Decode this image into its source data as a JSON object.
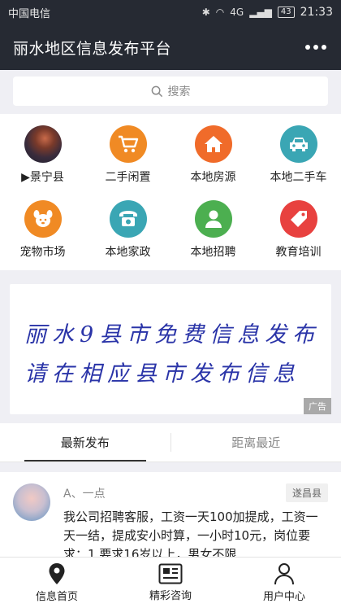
{
  "status_bar": {
    "carrier": "中国电信",
    "battery": "43",
    "time": "21:33",
    "network": "4G"
  },
  "header": {
    "title": "丽水地区信息发布平台"
  },
  "search": {
    "placeholder": "搜索"
  },
  "categories": [
    {
      "label": "▶景宁县",
      "icon": "region-avatar-icon",
      "color": "#3a2c3c"
    },
    {
      "label": "二手闲置",
      "icon": "shopping-cart-icon",
      "color": "#f08a24"
    },
    {
      "label": "本地房源",
      "icon": "house-icon",
      "color": "#f06b2a"
    },
    {
      "label": "本地二手车",
      "icon": "car-icon",
      "color": "#3aa6b4"
    },
    {
      "label": "宠物市场",
      "icon": "pet-icon",
      "color": "#f08a24"
    },
    {
      "label": "本地家政",
      "icon": "telephone-icon",
      "color": "#3aa6b4"
    },
    {
      "label": "本地招聘",
      "icon": "person-icon",
      "color": "#4caf50"
    },
    {
      "label": "教育培训",
      "icon": "price-tag-icon",
      "color": "#e8413f"
    }
  ],
  "banner": {
    "line1": "丽水9县市免费信息发布",
    "line2": "请在相应县市发布信息",
    "ad_label": "广告",
    "text_color": "#2a34a8"
  },
  "tabs": [
    {
      "label": "最新发布",
      "active": true
    },
    {
      "label": "距离最近",
      "active": false
    }
  ],
  "post": {
    "user": "A、一点",
    "tag": "遂昌县",
    "text": "我公司招聘客服，工资一天100加提成，工资一天一结，提成安小时算，一小时10元，岗位要求：1.要求16岁以上，男女不限"
  },
  "bottom_nav": [
    {
      "label": "信息首页",
      "icon": "location-pin-icon"
    },
    {
      "label": "精彩咨询",
      "icon": "news-icon"
    },
    {
      "label": "用户中心",
      "icon": "user-icon"
    }
  ]
}
